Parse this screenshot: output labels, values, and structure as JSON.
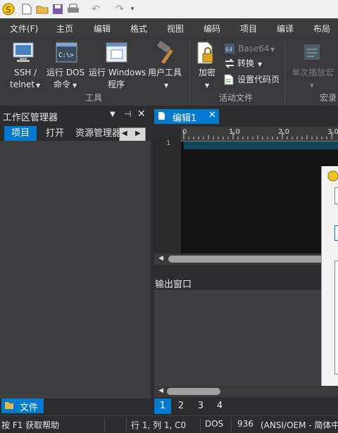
{
  "quick_access": {
    "icons": [
      "app-logo-icon",
      "new-file-icon",
      "open-folder-icon",
      "save-icon",
      "print-icon",
      "undo-icon",
      "redo-icon",
      "customize-arrow-icon"
    ]
  },
  "menu": [
    "文件(F)",
    "主页",
    "编辑",
    "格式",
    "视图",
    "编码",
    "项目",
    "编译",
    "布局"
  ],
  "ribbon": {
    "ssh_line1": "SSH /",
    "ssh_line2": "telnet",
    "dos_line1": "运行 DOS",
    "dos_line2": "命令",
    "win_line1": "运行 Windows",
    "win_line2": "程序",
    "user_tools": "用户工具",
    "group_tools": "工具",
    "encrypt": "加密",
    "base64": "Base64",
    "convert": "转换",
    "codepage": "设置代码页",
    "group_active": "活动文件",
    "replay_macro": "单次播放宏",
    "group_macro": "宏录"
  },
  "workspace": {
    "title": "工作区管理器",
    "tab_project": "项目",
    "tab_open": "打开",
    "tab_explorer": "资源管理器",
    "bottom_tab": "文件"
  },
  "editor": {
    "tab_name": "编辑1",
    "line_number": "1",
    "ruler_marks": [
      "0",
      "1,0",
      "2,0",
      "3,0"
    ]
  },
  "output": {
    "title": "输出窗口",
    "pages": [
      "1",
      "2",
      "3",
      "4"
    ]
  },
  "status": {
    "help": "按 F1 获取帮助",
    "position": "行 1, 列 1, C0",
    "line_ending": "DOS",
    "codepage_num": "936",
    "codepage_name": "(ANSI/OEM - 简体中"
  },
  "colors": {
    "accent": "#007acc",
    "background": "#2d2d30",
    "panel": "#3f3f41"
  }
}
